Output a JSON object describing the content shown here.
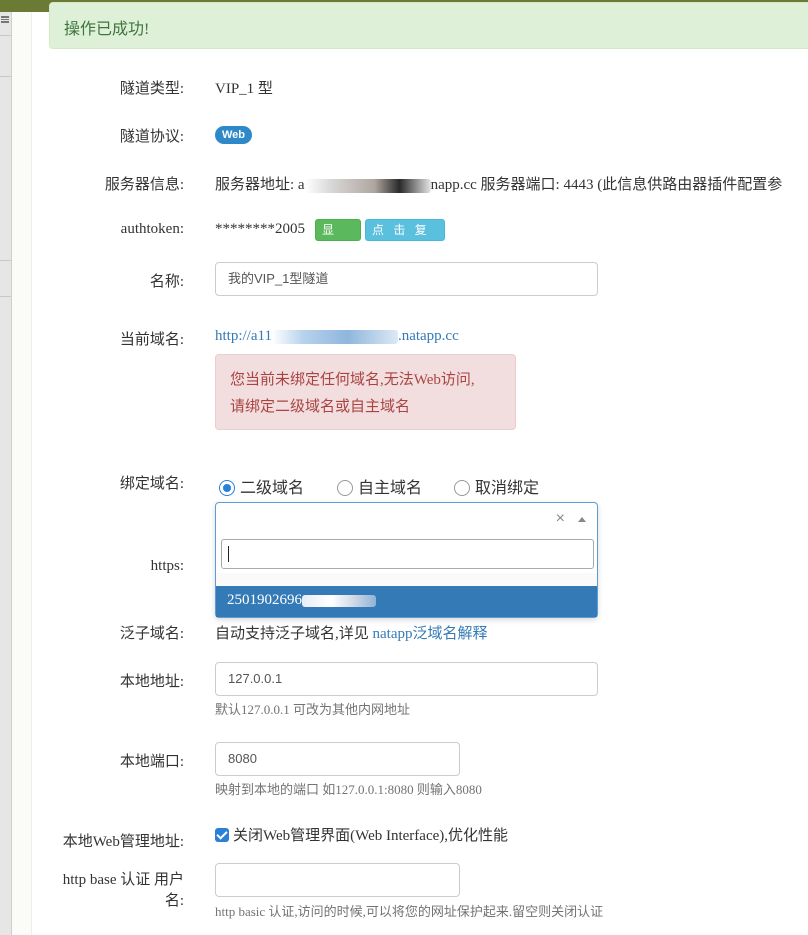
{
  "alert_success": "操作已成功!",
  "labels": {
    "tunnel_type": "隧道类型:",
    "tunnel_protocol": "隧道协议:",
    "server_info": "服务器信息:",
    "authtoken": "authtoken:",
    "name": "名称:",
    "current_domain": "当前域名:",
    "bind_domain": "绑定域名:",
    "https": "https:",
    "wildcard": "泛子域名:",
    "local_address": "本地地址:",
    "local_port": "本地端口:",
    "local_web_admin": "本地Web管理地址:",
    "http_base_auth": "http base 认证 用户名:"
  },
  "tunnel_type_value": "VIP_1 型",
  "protocol_badge": "Web",
  "server_info": {
    "prefix": "服务器地址: a",
    "suffix": "napp.cc 服务器端口: 4443 (此信息供路由器插件配置参"
  },
  "authtoken": {
    "masked": "********2005",
    "show_button": "显 示",
    "copy_button": "点 击 复 制"
  },
  "name_value": "我的VIP_1型隧道",
  "current_domain": {
    "prefix": "http://a11",
    "suffix": ".natapp.cc"
  },
  "alert_danger": {
    "line1": "您当前未绑定任何域名,无法Web访问,",
    "line2": "请绑定二级域名或自主域名"
  },
  "bind_options": [
    "二级域名",
    "自主域名",
    "取消绑定"
  ],
  "bind_selected": "二级域名",
  "select": {
    "clear_icon": "×",
    "search_value": "",
    "option_prefix": "2501902696"
  },
  "wildcard": {
    "text": "自动支持泛子域名,详见 ",
    "link": "natapp泛域名解释"
  },
  "local_address": {
    "value": "127.0.0.1",
    "help": "默认127.0.0.1 可改为其他内网地址"
  },
  "local_port": {
    "value": "8080",
    "help": "映射到本地的端口 如127.0.0.1:8080 则输入8080"
  },
  "web_admin": {
    "checked": true,
    "label": "关闭Web管理界面(Web Interface),优化性能"
  },
  "http_auth": {
    "value": "",
    "help": "http basic 认证,访问的时候,可以将您的网址保护起来.留空则关闭认证"
  },
  "colors": {
    "topbar": "#6b7a35",
    "success_bg": "#dff0d8",
    "danger_bg": "#f2dede",
    "primary": "#337ab7",
    "badge": "#2f89c9",
    "btn_green": "#5cb85c",
    "btn_info": "#5bc0de"
  }
}
